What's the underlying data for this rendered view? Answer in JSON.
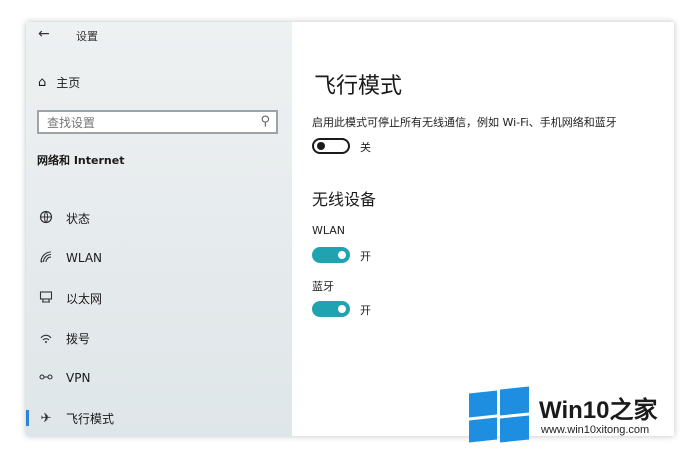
{
  "window": {
    "title": "设置"
  },
  "sidebar": {
    "home_label": "主页",
    "search_placeholder": "查找设置",
    "section_title": "网络和 Internet",
    "items": [
      {
        "label": "状态",
        "icon": "globe-icon"
      },
      {
        "label": "WLAN",
        "icon": "wifi-icon"
      },
      {
        "label": "以太网",
        "icon": "ethernet-icon"
      },
      {
        "label": "拨号",
        "icon": "dialup-icon"
      },
      {
        "label": "VPN",
        "icon": "vpn-icon"
      },
      {
        "label": "飞行模式",
        "icon": "airplane-icon",
        "active": true
      }
    ]
  },
  "content": {
    "title": "飞行模式",
    "description": "启用此模式可停止所有无线通信，例如 Wi-Fi、手机网络和蓝牙",
    "airplane_toggle": {
      "state": "关",
      "on": false
    },
    "wireless_title": "无线设备",
    "wlan": {
      "label": "WLAN",
      "state": "开",
      "on": true
    },
    "bluetooth": {
      "label": "蓝牙",
      "state": "开",
      "on": true
    }
  },
  "watermark": {
    "brand_prefix": "Win10",
    "brand_suffix": "之家",
    "url": "www.win10xitong.com"
  },
  "colors": {
    "accent": "#2c84d7",
    "toggle_on": "#1fa3b0",
    "logo_blue": "#1e8fe0"
  }
}
